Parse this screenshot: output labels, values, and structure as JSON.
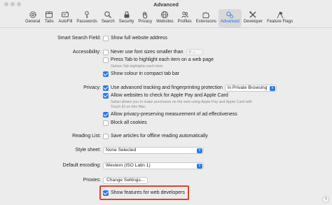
{
  "window": {
    "title": "Advanced"
  },
  "toolbar": {
    "items": [
      {
        "label": "General",
        "icon": "gear-icon"
      },
      {
        "label": "Tabs",
        "icon": "tabs-icon"
      },
      {
        "label": "AutoFill",
        "icon": "autofill-icon"
      },
      {
        "label": "Passwords",
        "icon": "key-icon"
      },
      {
        "label": "Search",
        "icon": "magnifier-icon"
      },
      {
        "label": "Security",
        "icon": "lock-icon"
      },
      {
        "label": "Privacy",
        "icon": "hand-icon"
      },
      {
        "label": "Websites",
        "icon": "globe-icon"
      },
      {
        "label": "Profiles",
        "icon": "people-icon"
      },
      {
        "label": "Extensions",
        "icon": "puzzle-icon"
      },
      {
        "label": "Advanced",
        "icon": "advanced-gears-icon",
        "active": true
      },
      {
        "label": "Developer",
        "icon": "tools-icon"
      },
      {
        "label": "Feature Flags",
        "icon": "flags-icon"
      }
    ]
  },
  "smart_search": {
    "label": "Smart Search Field:",
    "option": "Show full website address",
    "checked": false
  },
  "accessibility": {
    "label": "Accessibility:",
    "font_size_option": "Never use font sizes smaller than",
    "font_size_value": "9",
    "tab_option": "Press Tab to highlight each item on a web page",
    "tab_help": "Option-Tab highlights each item.",
    "colour_option": "Show colour in compact tab bar"
  },
  "privacy": {
    "label": "Privacy:",
    "tracking_option": "Use advanced tracking and fingerprinting protection",
    "tracking_mode": "in Private Browsing",
    "applepay_option": "Allow websites to check for Apple Pay and Apple Card",
    "applepay_help_1": "Safari allows you to make purchases on the web using Apple Pay and Apple Card with",
    "applepay_help_2": "Touch ID on this Mac.",
    "measurement_option": "Allow privacy-preserving measurement of ad effectiveness",
    "cookies_option": "Block all cookies"
  },
  "reading_list": {
    "label": "Reading List:",
    "option": "Save articles for offline reading automatically"
  },
  "style_sheet": {
    "label": "Style sheet:",
    "value": "None Selected"
  },
  "encoding": {
    "label": "Default encoding:",
    "value": "Western (ISO Latin 1)"
  },
  "proxies": {
    "label": "Proxies:",
    "button": "Change Settings..."
  },
  "developer": {
    "option": "Show features for web developers"
  },
  "colors": {
    "accent": "#2a7be4",
    "highlight": "#e0432d"
  }
}
